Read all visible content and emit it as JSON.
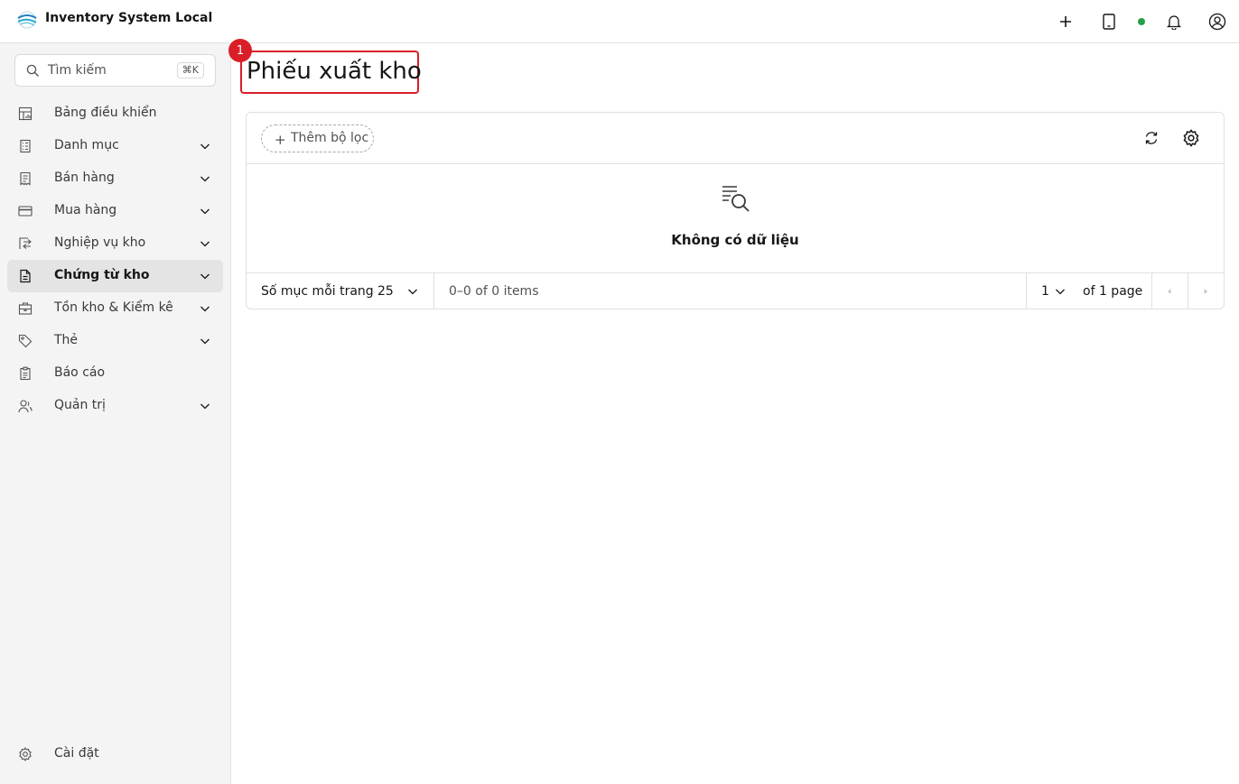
{
  "header": {
    "app_title": "Inventory System Local",
    "icons": [
      "add-icon",
      "tablet-icon",
      "status-online-dot",
      "notification-bell-icon",
      "user-avatar-icon"
    ],
    "status_color": "#24a148"
  },
  "sidebar": {
    "search": {
      "placeholder": "Tìm kiếm",
      "shortcut": "⌘K"
    },
    "items": [
      {
        "label": "Bảng điều khiển",
        "icon": "dashboard-icon",
        "expandable": false,
        "active": false
      },
      {
        "label": "Danh mục",
        "icon": "catalog-icon",
        "expandable": true,
        "active": false
      },
      {
        "label": "Bán hàng",
        "icon": "sales-receipt-icon",
        "expandable": true,
        "active": false
      },
      {
        "label": "Mua hàng",
        "icon": "purchase-card-icon",
        "expandable": true,
        "active": false
      },
      {
        "label": "Nghiệp vụ kho",
        "icon": "warehouse-operations-icon",
        "expandable": true,
        "active": false
      },
      {
        "label": "Chứng từ kho",
        "icon": "document-icon",
        "expandable": true,
        "active": true
      },
      {
        "label": "Tồn kho & Kiểm kê",
        "icon": "inventory-icon",
        "expandable": true,
        "active": false
      },
      {
        "label": "Thẻ",
        "icon": "tag-icon",
        "expandable": true,
        "active": false
      },
      {
        "label": "Báo cáo",
        "icon": "report-icon",
        "expandable": false,
        "active": false
      },
      {
        "label": "Quản trị",
        "icon": "admin-users-icon",
        "expandable": true,
        "active": false
      }
    ],
    "settings_label": "Cài đặt"
  },
  "main": {
    "page_title": "Phiếu xuất kho",
    "annotation_badge": "1",
    "toolbar": {
      "add_filter_label": "Thêm bộ lọc"
    },
    "empty_state": {
      "message": "Không có dữ liệu"
    },
    "pagination": {
      "items_per_page_label": "Số mục mỗi trang",
      "items_per_page_value": "25",
      "range_text": "0–0 of 0 items",
      "current_page": "1",
      "page_total_text": "of 1 page"
    }
  },
  "colors": {
    "accent_red": "#da1e28",
    "active_bg": "#e4e4e4",
    "sidebar_bg": "#f4f4f4"
  }
}
